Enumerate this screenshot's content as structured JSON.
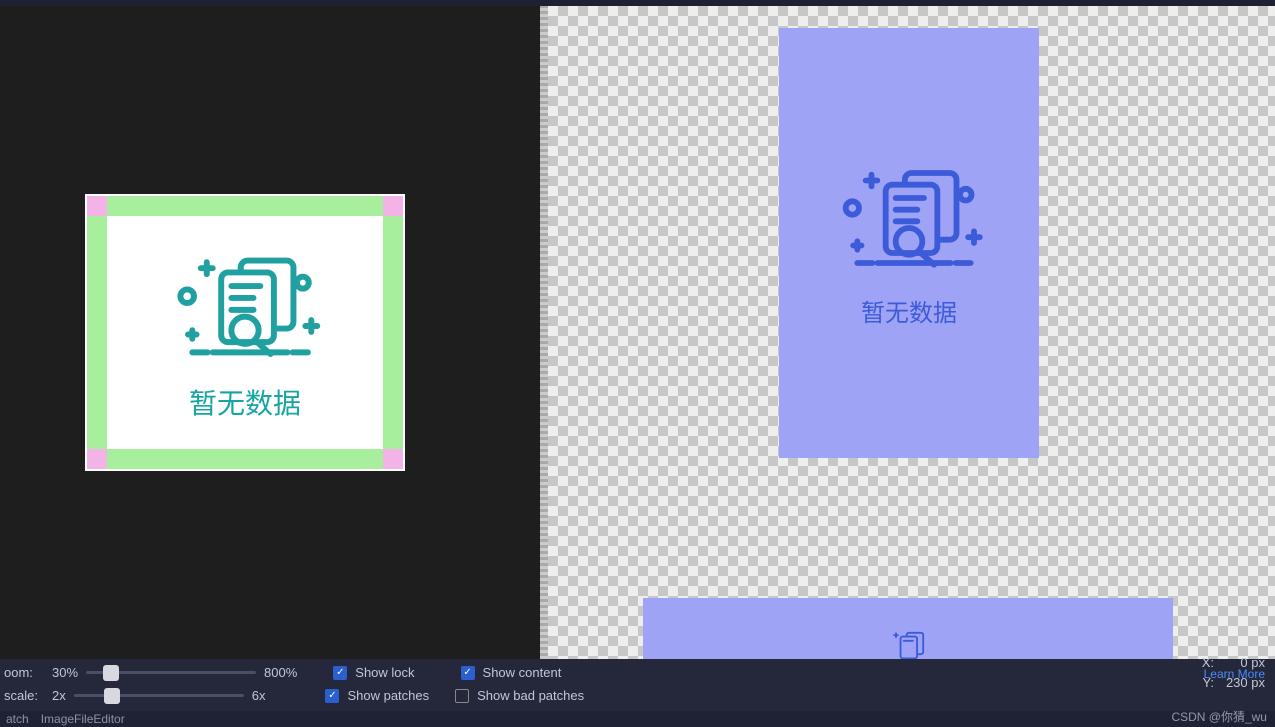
{
  "image_caption": "暂无数据",
  "preview_caption": "暂无数据",
  "controls": {
    "zoom": {
      "label": "oom:",
      "value": "30%",
      "min": "",
      "max": "800%",
      "thumb_pct": 10
    },
    "scale": {
      "label": "scale:",
      "value": "2x",
      "min": "",
      "max": "6x",
      "thumb_pct": 18
    },
    "show_lock": {
      "label": "Show lock",
      "checked": true
    },
    "show_patches": {
      "label": "Show patches",
      "checked": true
    },
    "show_content": {
      "label": "Show content",
      "checked": true
    },
    "show_bad_patches": {
      "label": "Show bad patches",
      "checked": false
    }
  },
  "coords": {
    "x_label": "X:",
    "x_value": "0",
    "x_unit": "px",
    "y_label": "Y:",
    "y_value": "230",
    "y_unit": "px"
  },
  "learn_more": "Learn More",
  "status": {
    "atch": "atch",
    "editor": "ImageFileEditor"
  },
  "watermark": "CSDN @你猜_wu"
}
